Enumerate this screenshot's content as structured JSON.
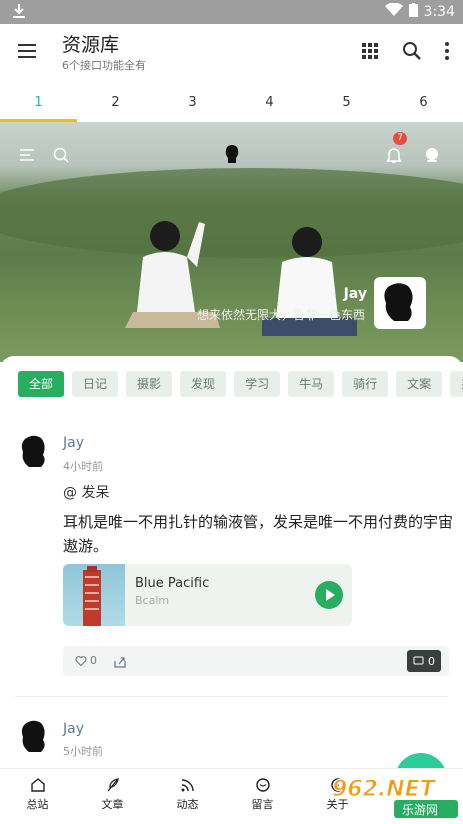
{
  "status_bar": {
    "time": "3:34"
  },
  "appbar": {
    "title": "资源库",
    "subtitle": "6个接口功能全有"
  },
  "tabs": [
    {
      "label": "1"
    },
    {
      "label": "2"
    },
    {
      "label": "3"
    },
    {
      "label": "4"
    },
    {
      "label": "5"
    },
    {
      "label": "6"
    }
  ],
  "hero": {
    "notification_count": "7",
    "name": "Jay",
    "motto": "想来依然无限大，香非一色东西"
  },
  "chips": [
    {
      "label": "全部"
    },
    {
      "label": "日记"
    },
    {
      "label": "摄影"
    },
    {
      "label": "发现"
    },
    {
      "label": "学习"
    },
    {
      "label": "牛马"
    },
    {
      "label": "骑行"
    },
    {
      "label": "文案"
    },
    {
      "label": "杰伦"
    }
  ],
  "posts": [
    {
      "name": "Jay",
      "time": "4小时前",
      "tag": "@ 发呆",
      "text": "耳机是唯一不用扎针的输液管，发呆是唯一不用付费的宇宙遨游。",
      "music": {
        "title": "Blue Pacific",
        "artist": "Bcalm"
      },
      "likes": "0",
      "comments": "0"
    },
    {
      "name": "Jay",
      "time": "5小时前"
    }
  ],
  "bottom_nav": [
    {
      "label": "总站"
    },
    {
      "label": "文章"
    },
    {
      "label": "动态"
    },
    {
      "label": "留言"
    },
    {
      "label": "关于"
    }
  ],
  "watermark": {
    "text": "962.NET",
    "sub": "乐游网"
  },
  "colors": {
    "accent": "#1abc9c",
    "green": "#27ae60",
    "indicator": "#f2c200"
  }
}
